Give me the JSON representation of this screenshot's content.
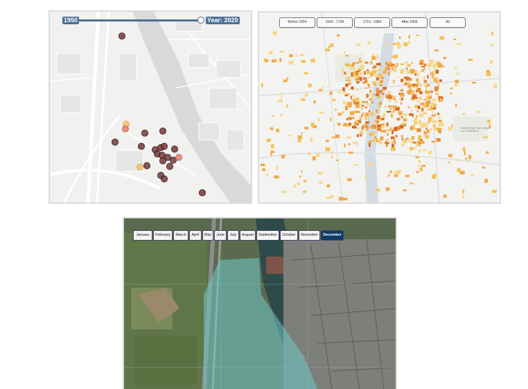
{
  "timeline_panel": {
    "start_year": "1950",
    "end_label": "Year: 2020"
  },
  "period_panel": {
    "buttons": [
      "Before 1554",
      "1555 - 1709",
      "1710 - 1864",
      "After 1865",
      "All"
    ],
    "district_label": "L'HOSPITALET DE LA MAR / LA CIUDADELA"
  },
  "month_panel": {
    "months": [
      "January",
      "February",
      "March",
      "April",
      "May",
      "June",
      "July",
      "August",
      "September",
      "October",
      "November",
      "December"
    ],
    "active_month": "December"
  },
  "colors": {
    "slider": "#4d6f94",
    "active_month": "#0f3b66",
    "dot_dark": "#6b2a2a",
    "building_light": "#f5c15a",
    "building_dark": "#d97a1e",
    "water_overlay": "#6fc8c8"
  }
}
